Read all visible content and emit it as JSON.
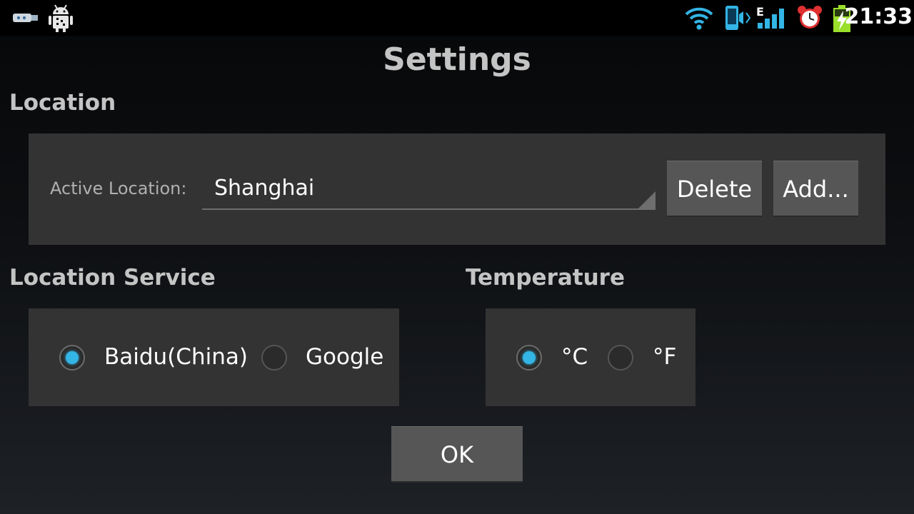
{
  "status_bar": {
    "left_icons": [
      "usb-icon",
      "android-debug-icon"
    ],
    "right_icons": [
      "wifi-icon",
      "vibrate-icon",
      "signal-e-icon",
      "alarm-icon",
      "battery-charging-icon"
    ],
    "signal_type": "E",
    "time": "21:33"
  },
  "title": "Settings",
  "location": {
    "heading": "Location",
    "active_label": "Active Location:",
    "active_value": "Shanghai",
    "delete_label": "Delete",
    "add_label": "Add..."
  },
  "location_service": {
    "heading": "Location Service",
    "options": [
      {
        "label": "Baidu(China)",
        "checked": true
      },
      {
        "label": "Google",
        "checked": false
      }
    ]
  },
  "temperature": {
    "heading": "Temperature",
    "options": [
      {
        "label": "°C",
        "checked": true
      },
      {
        "label": "°F",
        "checked": false
      }
    ]
  },
  "ok_label": "OK",
  "colors": {
    "accent": "#33b5e5",
    "panel": "#333333",
    "button": "#565656",
    "heading": "#c4c4c4"
  }
}
